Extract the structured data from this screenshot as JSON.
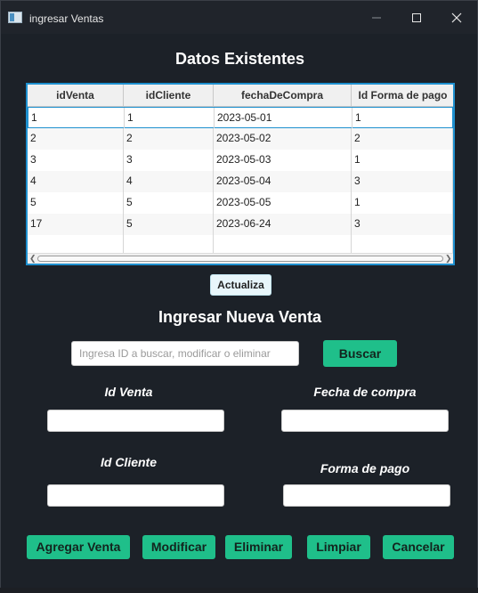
{
  "window": {
    "title": "ingresar Ventas"
  },
  "existing": {
    "heading": "Datos Existentes",
    "columns": [
      "idVenta",
      "idCliente",
      "fechaDeCompra",
      "Id Forma de pago"
    ],
    "rows": [
      [
        "1",
        "1",
        "2023-05-01",
        "1"
      ],
      [
        "2",
        "2",
        "2023-05-02",
        "2"
      ],
      [
        "3",
        "3",
        "2023-05-03",
        "1"
      ],
      [
        "4",
        "4",
        "2023-05-04",
        "3"
      ],
      [
        "5",
        "5",
        "2023-05-05",
        "1"
      ],
      [
        "17",
        "5",
        "2023-06-24",
        "3"
      ]
    ],
    "refresh_label": "Actualiza"
  },
  "form": {
    "heading": "Ingresar Nueva Venta",
    "search_placeholder": "Ingresa ID a buscar, modificar o eliminar",
    "search_button": "Buscar",
    "id_venta_label": "Id Venta",
    "fecha_label": "Fecha de compra",
    "id_cliente_label": "Id Cliente",
    "forma_pago_label": "Forma de pago"
  },
  "actions": {
    "agregar": "Agregar Venta",
    "modificar": "Modificar",
    "eliminar": "Eliminar",
    "limpiar": "Limpiar",
    "cancelar": "Cancelar"
  },
  "colors": {
    "accent_green": "#1fbf8a",
    "selection_blue": "#1e90cf",
    "background": "#1c2128"
  }
}
